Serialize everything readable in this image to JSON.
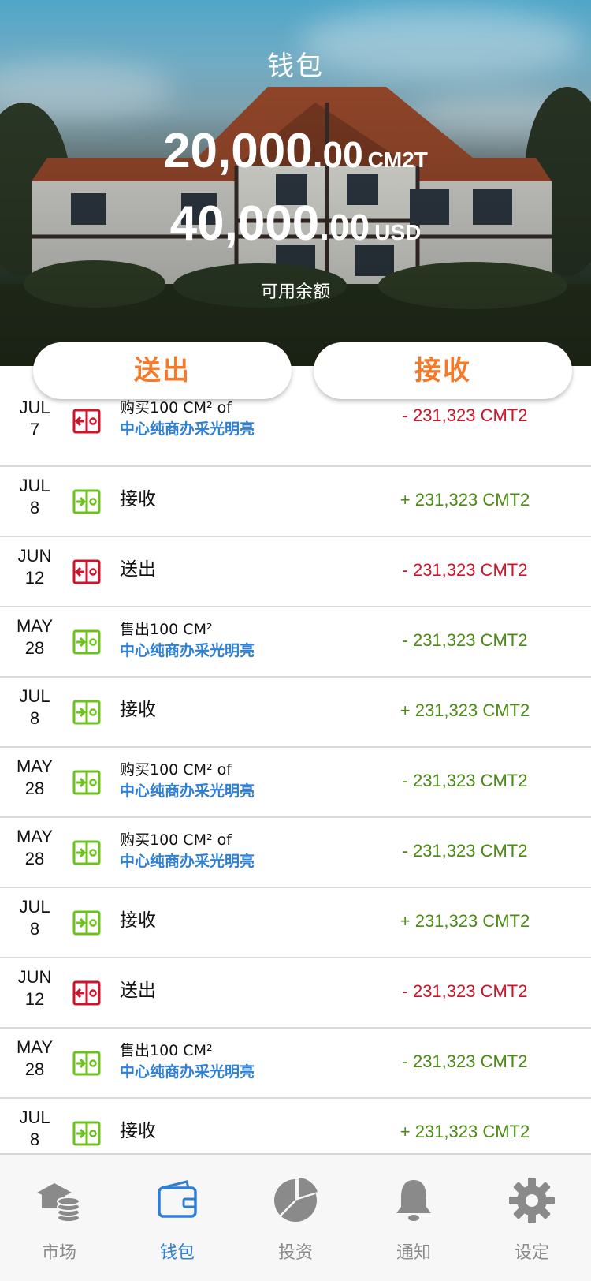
{
  "header": {
    "title": "钱包",
    "balance_cm2t": {
      "int": "20,000",
      "dec": ".00",
      "unit": "CM2T"
    },
    "balance_usd": {
      "int": "40,000",
      "dec": ".00",
      "unit": "USD"
    },
    "available_label": "可用余额"
  },
  "actions": {
    "send_label": "送出",
    "receive_label": "接收"
  },
  "transactions": [
    {
      "month": "JUL",
      "day": "7",
      "icon": "send-icon",
      "icon_color": "#d0122a",
      "line1": "购买100 CM² of",
      "line2": "中心纯商办采光明亮",
      "amount": "- 231,323 CMT2",
      "amount_color": "red"
    },
    {
      "month": "JUL",
      "day": "8",
      "icon": "receive-icon",
      "icon_color": "#6cc21c",
      "line1": "接收",
      "line2": "",
      "amount": "+ 231,323 CMT2",
      "amount_color": "green"
    },
    {
      "month": "JUN",
      "day": "12",
      "icon": "send-icon",
      "icon_color": "#d0122a",
      "line1": "送出",
      "line2": "",
      "amount": "- 231,323 CMT2",
      "amount_color": "red"
    },
    {
      "month": "MAY",
      "day": "28",
      "icon": "receive-icon",
      "icon_color": "#6cc21c",
      "line1": "售出100 CM²",
      "line2": "中心纯商办采光明亮",
      "amount": "- 231,323 CMT2",
      "amount_color": "green"
    },
    {
      "month": "JUL",
      "day": "8",
      "icon": "receive-icon",
      "icon_color": "#6cc21c",
      "line1": "接收",
      "line2": "",
      "amount": "+ 231,323 CMT2",
      "amount_color": "green"
    },
    {
      "month": "MAY",
      "day": "28",
      "icon": "receive-icon",
      "icon_color": "#6cc21c",
      "line1": "购买100 CM² of",
      "line2": "中心纯商办采光明亮",
      "amount": "- 231,323 CMT2",
      "amount_color": "green"
    },
    {
      "month": "MAY",
      "day": "28",
      "icon": "receive-icon",
      "icon_color": "#6cc21c",
      "line1": "购买100 CM² of",
      "line2": "中心纯商办采光明亮",
      "amount": "- 231,323 CMT2",
      "amount_color": "green"
    },
    {
      "month": "JUL",
      "day": "8",
      "icon": "receive-icon",
      "icon_color": "#6cc21c",
      "line1": "接收",
      "line2": "",
      "amount": "+ 231,323 CMT2",
      "amount_color": "green"
    },
    {
      "month": "JUN",
      "day": "12",
      "icon": "send-icon",
      "icon_color": "#d0122a",
      "line1": "送出",
      "line2": "",
      "amount": "- 231,323 CMT2",
      "amount_color": "red"
    },
    {
      "month": "MAY",
      "day": "28",
      "icon": "receive-icon",
      "icon_color": "#6cc21c",
      "line1": "售出100 CM²",
      "line2": "中心纯商办采光明亮",
      "amount": "- 231,323 CMT2",
      "amount_color": "green"
    },
    {
      "month": "JUL",
      "day": "8",
      "icon": "receive-icon",
      "icon_color": "#6cc21c",
      "line1": "接收",
      "line2": "",
      "amount": "+ 231,323 CMT2",
      "amount_color": "green"
    }
  ],
  "tabbar": {
    "active": "wallet",
    "items": [
      {
        "key": "market",
        "label": "市场",
        "icon": "market-icon"
      },
      {
        "key": "wallet",
        "label": "钱包",
        "icon": "wallet-icon"
      },
      {
        "key": "invest",
        "label": "投资",
        "icon": "pie-chart-icon"
      },
      {
        "key": "notify",
        "label": "通知",
        "icon": "bell-icon"
      },
      {
        "key": "settings",
        "label": "设定",
        "icon": "gear-icon"
      }
    ]
  },
  "colors": {
    "accent": "#f47a2a",
    "link": "#2e7fd6",
    "negative": "#d0122a",
    "positive": "#4b8a12",
    "tab_inactive": "#8a8a8a"
  }
}
